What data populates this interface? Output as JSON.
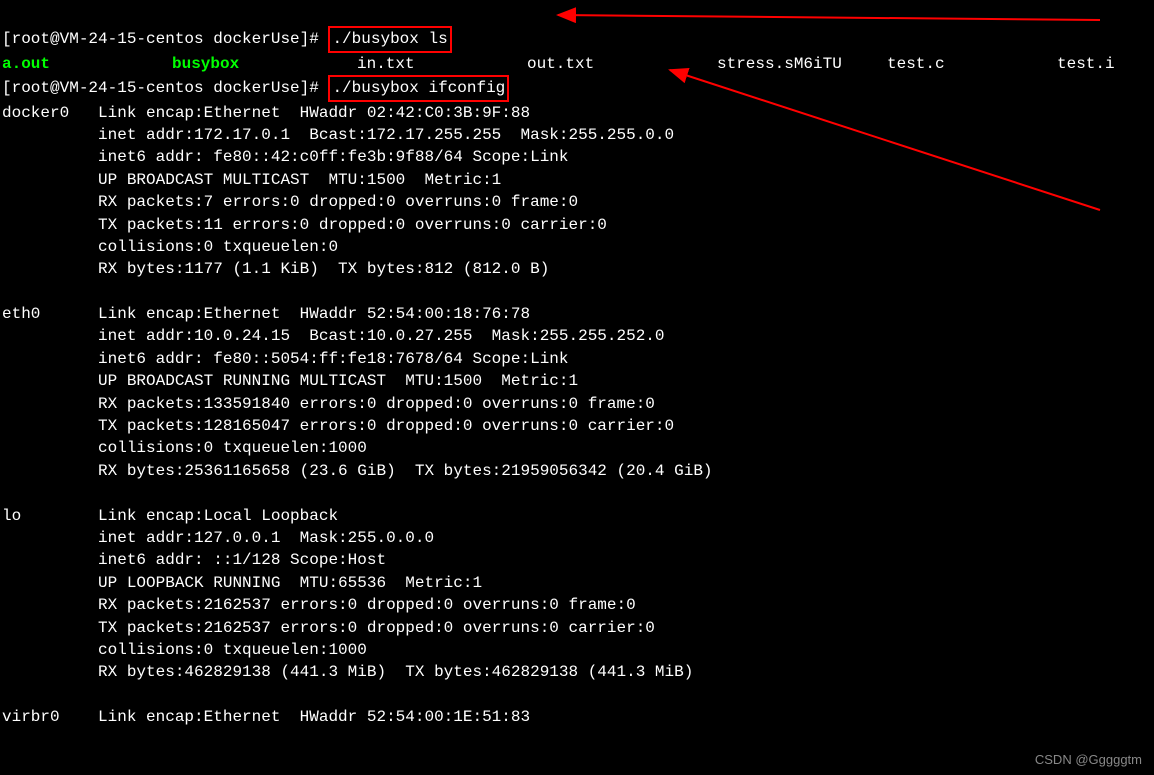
{
  "prompt1": {
    "text": "[root@VM-24-15-centos dockerUse]# ",
    "cmd": "./busybox ls"
  },
  "ls": {
    "files": [
      {
        "name": "a.out",
        "cls": "green"
      },
      {
        "name": "busybox",
        "cls": "green"
      },
      {
        "name": "in.txt",
        "cls": "white"
      },
      {
        "name": "out.txt",
        "cls": "white"
      },
      {
        "name": "stress.sM6iTU",
        "cls": "white"
      },
      {
        "name": "test.c",
        "cls": "white"
      },
      {
        "name": "test.i",
        "cls": "white"
      }
    ]
  },
  "prompt2": {
    "text": "[root@VM-24-15-centos dockerUse]# ",
    "cmd": "./busybox ifconfig"
  },
  "ifconfig": {
    "docker0": [
      "docker0   Link encap:Ethernet  HWaddr 02:42:C0:3B:9F:88",
      "          inet addr:172.17.0.1  Bcast:172.17.255.255  Mask:255.255.0.0",
      "          inet6 addr: fe80::42:c0ff:fe3b:9f88/64 Scope:Link",
      "          UP BROADCAST MULTICAST  MTU:1500  Metric:1",
      "          RX packets:7 errors:0 dropped:0 overruns:0 frame:0",
      "          TX packets:11 errors:0 dropped:0 overruns:0 carrier:0",
      "          collisions:0 txqueuelen:0",
      "          RX bytes:1177 (1.1 KiB)  TX bytes:812 (812.0 B)",
      ""
    ],
    "eth0": [
      "eth0      Link encap:Ethernet  HWaddr 52:54:00:18:76:78",
      "          inet addr:10.0.24.15  Bcast:10.0.27.255  Mask:255.255.252.0",
      "          inet6 addr: fe80::5054:ff:fe18:7678/64 Scope:Link",
      "          UP BROADCAST RUNNING MULTICAST  MTU:1500  Metric:1",
      "          RX packets:133591840 errors:0 dropped:0 overruns:0 frame:0",
      "          TX packets:128165047 errors:0 dropped:0 overruns:0 carrier:0",
      "          collisions:0 txqueuelen:1000",
      "          RX bytes:25361165658 (23.6 GiB)  TX bytes:21959056342 (20.4 GiB)",
      ""
    ],
    "lo": [
      "lo        Link encap:Local Loopback",
      "          inet addr:127.0.0.1  Mask:255.0.0.0",
      "          inet6 addr: ::1/128 Scope:Host",
      "          UP LOOPBACK RUNNING  MTU:65536  Metric:1",
      "          RX packets:2162537 errors:0 dropped:0 overruns:0 frame:0",
      "          TX packets:2162537 errors:0 dropped:0 overruns:0 carrier:0",
      "          collisions:0 txqueuelen:1000",
      "          RX bytes:462829138 (441.3 MiB)  TX bytes:462829138 (441.3 MiB)",
      ""
    ],
    "virbr0": [
      "virbr0    Link encap:Ethernet  HWaddr 52:54:00:1E:51:83"
    ]
  },
  "watermark": "CSDN @Gggggtm"
}
